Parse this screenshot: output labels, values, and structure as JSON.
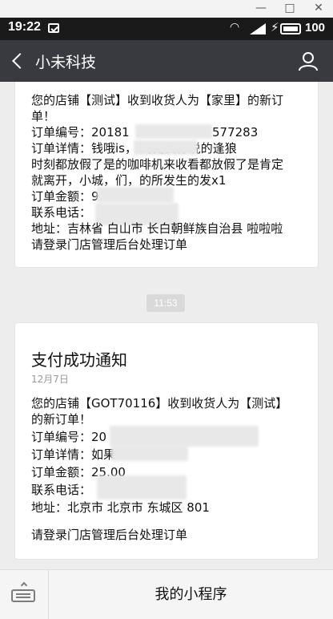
{
  "window": {
    "minimize": "—",
    "maximize": "□",
    "close": "✕"
  },
  "status": {
    "time": "19:22",
    "battery": "100"
  },
  "header": {
    "title": "小未科技",
    "back_icon": "back-arrow-icon",
    "profile_icon": "person-icon"
  },
  "message1": {
    "lines": [
      "您的店铺【测试】收到收货人为【家里】的新订",
      "单！",
      "订单编号：20181",
      "订单详情：钱哦is，        的免费你说的逢狼",
      "时刻都放假了是的咖啡机来收看都放假了是肯定",
      "就离开，小城，们，的所发生的发x1",
      "订单金额：9",
      "联系电话：",
      "地址：吉林省 白山市 长白朝鲜族自治县 啦啦啦",
      "请登录门店管理后台处理订单"
    ],
    "order_suffix": "577283"
  },
  "timestamp": "11:53",
  "message2": {
    "title": "支付成功通知",
    "date": "12月7日",
    "lines": [
      "您的店铺【GOT70116】收到收货人为【测试】",
      "的新订单！",
      "订单编号：20",
      "订单详情：如果",
      "订单金额：25.00",
      "联系电话：",
      "地址：北京市 北京市 东城区 801",
      "",
      "请登录门店管理后台处理订单"
    ]
  },
  "bottom": {
    "mini_program": "我的小程序",
    "keyboard_icon": "keyboard-icon"
  }
}
